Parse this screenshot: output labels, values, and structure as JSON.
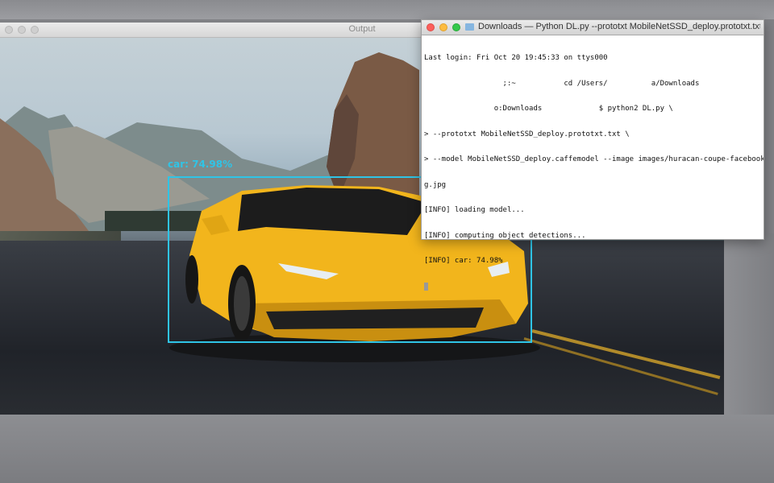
{
  "output_window": {
    "title": "Output"
  },
  "detection": {
    "label": "car: 74.98%",
    "color": "#2fc4e6"
  },
  "terminal": {
    "title": "Downloads — Python DL.py --prototxt MobileNetSSD_deploy.prototxt.txt --mo...",
    "lines": [
      "Last login: Fri Oct 20 19:45:33 on ttys000",
      "                  ;:~           cd /Users/          a/Downloads",
      "                o:Downloads             $ python2 DL.py \\",
      "> --prototxt MobileNetSSD_deploy.prototxt.txt \\",
      "> --model MobileNetSSD_deploy.caffemodel --image images/huracan-coupe-facebook-o",
      "g.jpg",
      "[INFO] loading model...",
      "[INFO] computing object detections...",
      "[INFO] car: 74.98%"
    ]
  },
  "colors": {
    "close": "#fc605c",
    "minimize": "#fdbc40",
    "maximize": "#34c84a",
    "car": "#f2b51c"
  }
}
